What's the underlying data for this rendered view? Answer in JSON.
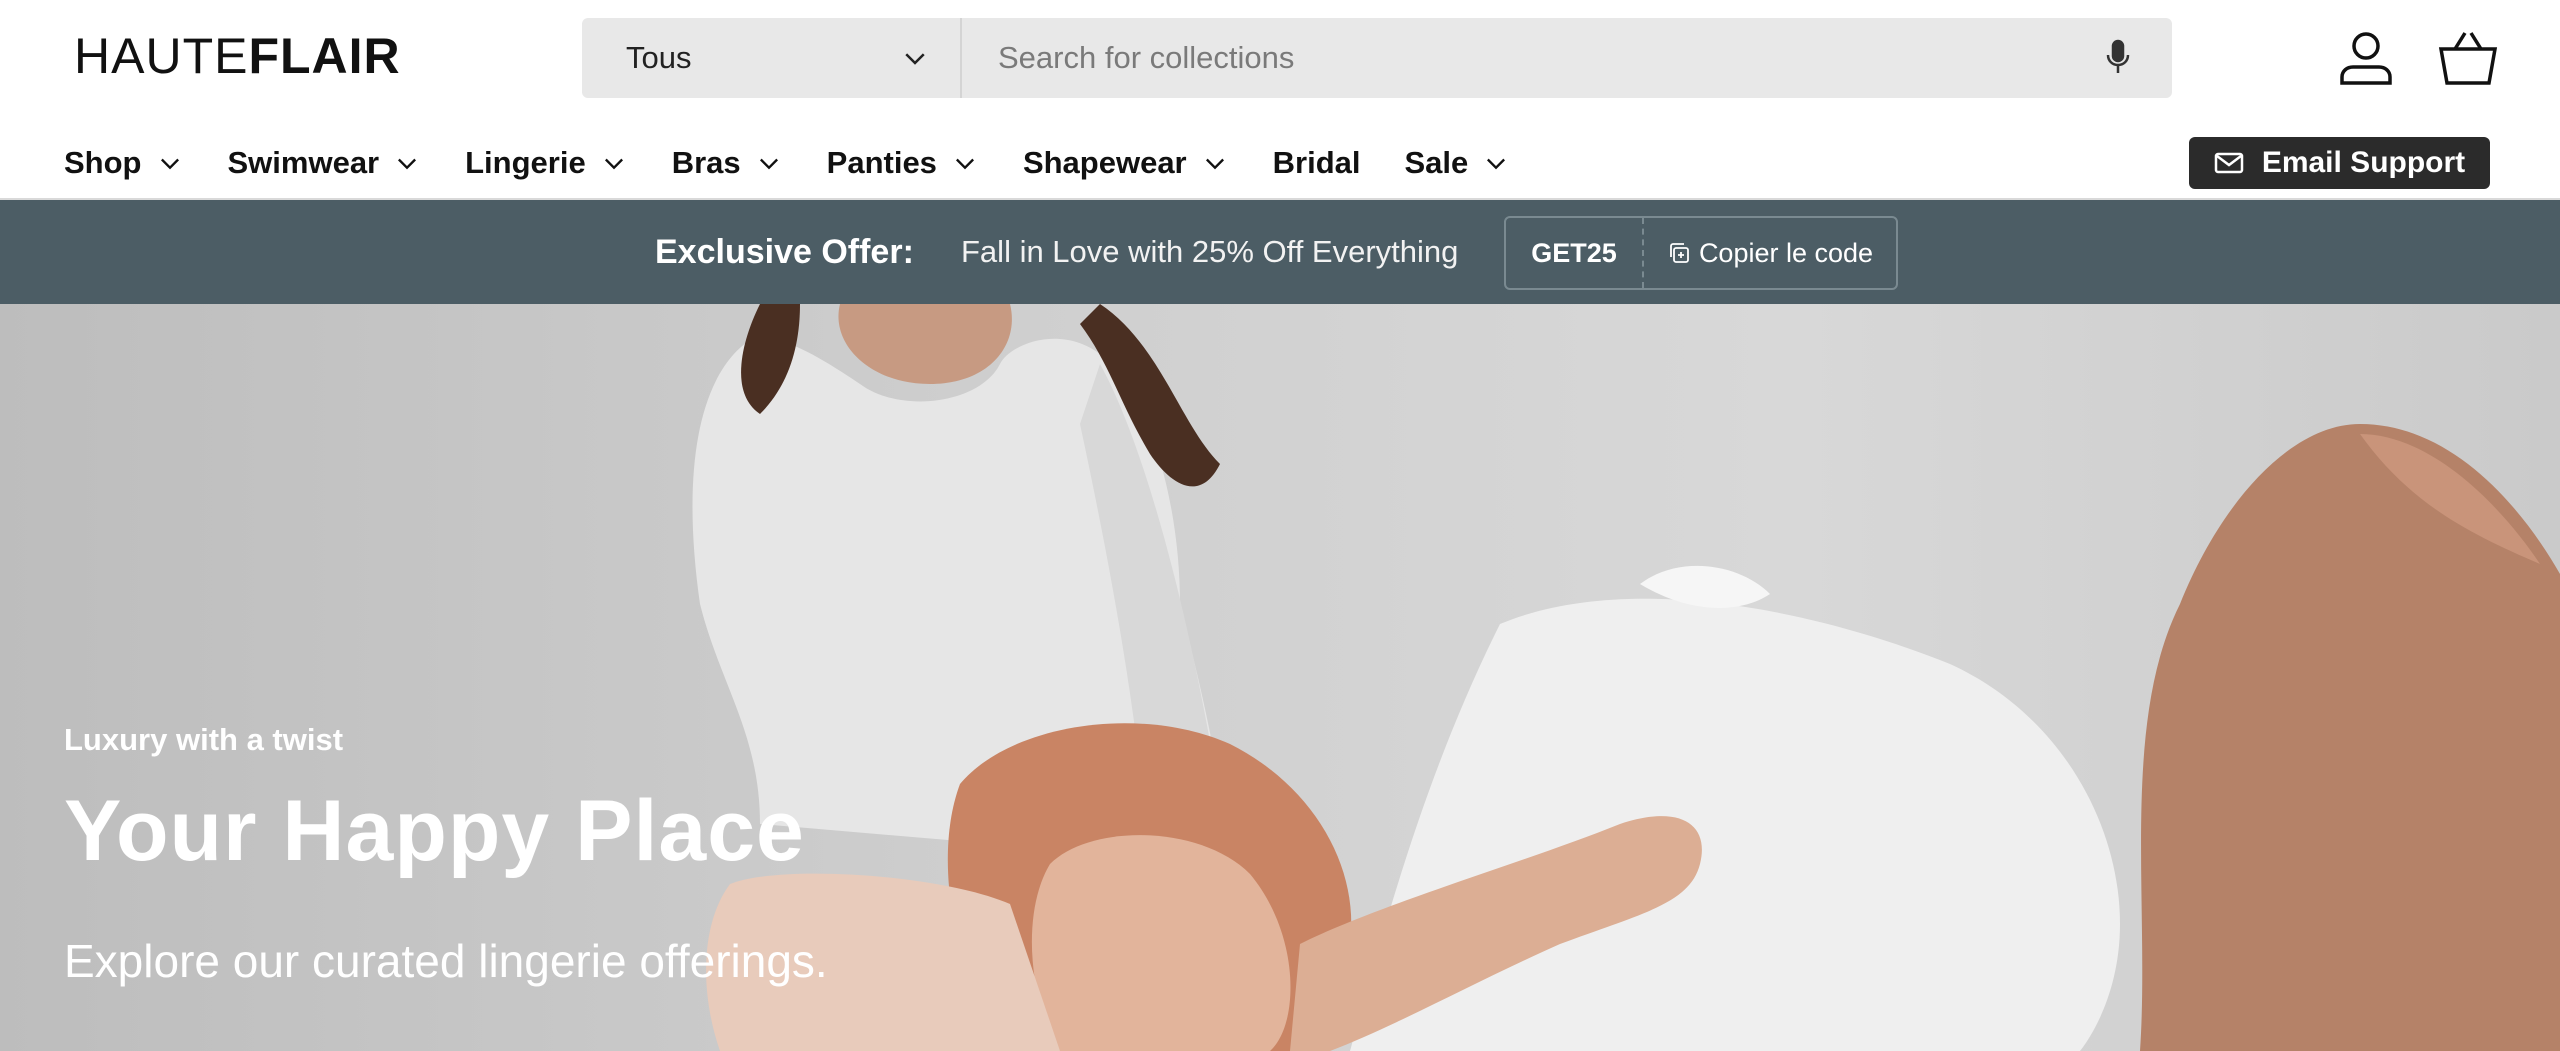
{
  "brand": {
    "logo_light": "HAUTE",
    "logo_bold": "FLAIR"
  },
  "search": {
    "category_selected": "Tous",
    "placeholder": "Search for collections"
  },
  "nav": {
    "items": [
      {
        "label": "Shop",
        "has_dropdown": true
      },
      {
        "label": "Swimwear",
        "has_dropdown": true
      },
      {
        "label": "Lingerie",
        "has_dropdown": true
      },
      {
        "label": "Bras",
        "has_dropdown": true
      },
      {
        "label": "Panties",
        "has_dropdown": true
      },
      {
        "label": "Shapewear",
        "has_dropdown": true
      },
      {
        "label": "Bridal",
        "has_dropdown": false
      },
      {
        "label": "Sale",
        "has_dropdown": true
      }
    ],
    "email_support": "Email Support"
  },
  "promo": {
    "label": "Exclusive Offer:",
    "text": "Fall in Love with 25% Off Everything",
    "code": "GET25",
    "copy_label": "Copier le code"
  },
  "hero": {
    "eyebrow": "Luxury with a twist",
    "title": "Your Happy Place",
    "subtitle": "Explore our curated lingerie offerings."
  },
  "colors": {
    "promo_bg": "#4c5d65",
    "button_bg": "#2b2b2b",
    "search_bg": "#e8e8e8"
  },
  "icons": [
    "chevron-down-icon",
    "microphone-icon",
    "account-icon",
    "basket-icon",
    "mail-icon",
    "copy-icon"
  ]
}
